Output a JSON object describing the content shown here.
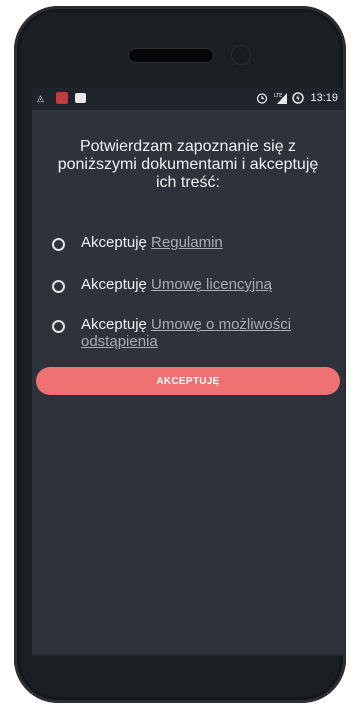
{
  "statusbar": {
    "left_icons": [
      "signal-data-icon",
      "app-notification-icon",
      "bbm-icon"
    ],
    "right_icons": [
      "alarm-icon",
      "lte-signal-icon",
      "battery-charging-icon"
    ],
    "time": "13:19"
  },
  "consent": {
    "heading_lines": [
      "Potwierdzam zapoznanie się z",
      "poniższymi dokumentami i akceptuję",
      "ich treść:"
    ],
    "items": [
      {
        "prefix": "Akceptuję ",
        "link": "Regulamin"
      },
      {
        "prefix": "Akceptuję ",
        "link": "Umowę licencyjną"
      },
      {
        "prefix": "Akceptuję ",
        "link": "Umowę o możliwości odstąpienia"
      }
    ],
    "accept_button": "AKCEPTUJĘ"
  },
  "colors": {
    "background": "#2d323b",
    "accent_button": "#ef7070",
    "link_text": "#a9adb5"
  }
}
